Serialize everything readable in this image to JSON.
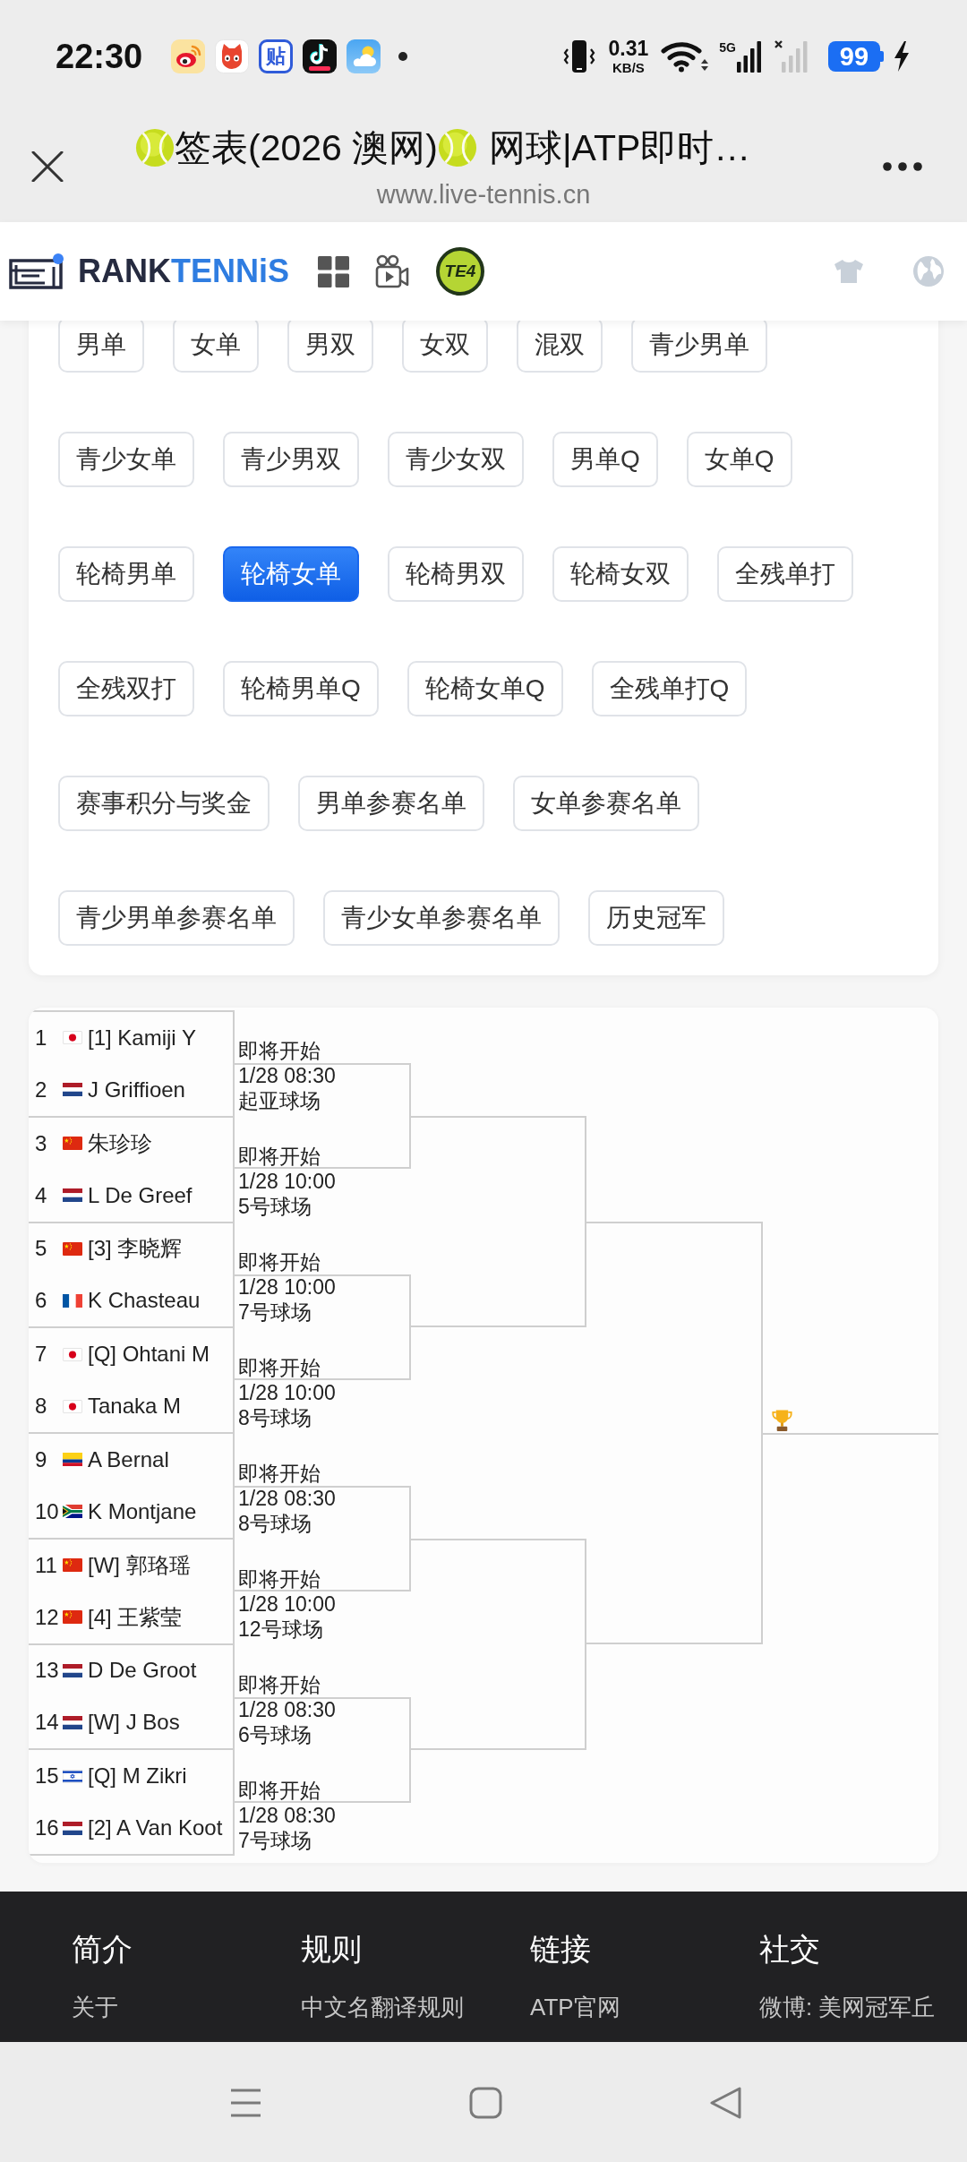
{
  "status_bar": {
    "time": "22:30",
    "app_icons": [
      {
        "kind": "eye"
      },
      {
        "kind": "cat"
      },
      {
        "kind": "glyph",
        "label": "贴"
      },
      {
        "kind": "note"
      },
      {
        "kind": "weather"
      }
    ],
    "net_speed": "0.31",
    "net_unit": "KB/S",
    "network_type": "5G",
    "battery": "99"
  },
  "browser": {
    "title": [
      {
        "ball": true,
        "text": "签表(2026 澳网)"
      },
      {
        "ball": true,
        "text": "网球|ATP即时…"
      }
    ],
    "url": "www.live-tennis.cn"
  },
  "site_header": {
    "brand": [
      "RANK",
      "TENNiS"
    ],
    "badge": "TE4"
  },
  "categories": {
    "tabs": [
      {
        "label": "男单",
        "selected": false
      },
      {
        "label": "女单",
        "selected": false
      },
      {
        "label": "男双",
        "selected": false
      },
      {
        "label": "女双",
        "selected": false
      },
      {
        "label": "混双",
        "selected": false
      },
      {
        "label": "青少男单",
        "selected": false
      },
      {
        "label": "青少女单",
        "selected": false
      },
      {
        "label": "青少男双",
        "selected": false
      },
      {
        "label": "青少女双",
        "selected": false
      },
      {
        "label": "男单Q",
        "selected": false
      },
      {
        "label": "女单Q",
        "selected": false
      },
      {
        "label": "轮椅男单",
        "selected": false
      },
      {
        "label": "轮椅女单",
        "selected": true
      },
      {
        "label": "轮椅男双",
        "selected": false
      },
      {
        "label": "轮椅女双",
        "selected": false
      },
      {
        "label": "全残单打",
        "selected": false
      },
      {
        "label": "全残双打",
        "selected": false
      },
      {
        "label": "轮椅男单Q",
        "selected": false
      },
      {
        "label": "轮椅女单Q",
        "selected": false
      },
      {
        "label": "全残单打Q",
        "selected": false
      },
      {
        "label": "赛事积分与奖金",
        "selected": false
      },
      {
        "label": "男单参赛名单",
        "selected": false
      },
      {
        "label": "女单参赛名单",
        "selected": false
      },
      {
        "label": "青少男单参赛名单",
        "selected": false
      },
      {
        "label": "青少女单参赛名单",
        "selected": false
      },
      {
        "label": "历史冠军",
        "selected": false
      }
    ]
  },
  "draw": {
    "players": [
      {
        "number": "1",
        "kind": "jp",
        "name": "[1] Kamiji Y"
      },
      {
        "number": "2",
        "kind": "nl",
        "name": "J Griffioen"
      },
      {
        "number": "3",
        "kind": "cn",
        "name": "朱珍珍"
      },
      {
        "number": "4",
        "kind": "nl",
        "name": "L De Greef"
      },
      {
        "number": "5",
        "kind": "cn",
        "name": "[3] 李晓辉"
      },
      {
        "number": "6",
        "kind": "fr",
        "name": "K Chasteau"
      },
      {
        "number": "7",
        "kind": "jp",
        "name": "[Q] Ohtani M"
      },
      {
        "number": "8",
        "kind": "jp",
        "name": "Tanaka M"
      },
      {
        "number": "9",
        "kind": "co",
        "name": "A Bernal"
      },
      {
        "number": "10",
        "kind": "za",
        "name": "K Montjane"
      },
      {
        "number": "11",
        "kind": "cn",
        "name": "[W] 郭珞瑶"
      },
      {
        "number": "12",
        "kind": "cn",
        "name": "[4] 王紫莹"
      },
      {
        "number": "13",
        "kind": "nl",
        "name": "D De Groot"
      },
      {
        "number": "14",
        "kind": "nl",
        "name": "[W] J Bos"
      },
      {
        "number": "15",
        "kind": "il",
        "name": "[Q] M Zikri"
      },
      {
        "number": "16",
        "kind": "nl",
        "name": "[2] A Van Koot"
      }
    ],
    "matches": [
      {
        "status": "即将开始",
        "time": "1/28 08:30",
        "court": "起亚球场"
      },
      {
        "status": "即将开始",
        "time": "1/28 10:00",
        "court": "5号球场"
      },
      {
        "status": "即将开始",
        "time": "1/28 10:00",
        "court": "7号球场"
      },
      {
        "status": "即将开始",
        "time": "1/28 10:00",
        "court": "8号球场"
      },
      {
        "status": "即将开始",
        "time": "1/28 08:30",
        "court": "8号球场"
      },
      {
        "status": "即将开始",
        "time": "1/28 10:00",
        "court": "12号球场"
      },
      {
        "status": "即将开始",
        "time": "1/28 08:30",
        "court": "6号球场"
      },
      {
        "status": "即将开始",
        "time": "1/28 08:30",
        "court": "7号球场"
      }
    ]
  },
  "footer": {
    "columns": [
      {
        "heading": "简介",
        "link": "关于"
      },
      {
        "heading": "规则",
        "link": "中文名翻译规则"
      },
      {
        "heading": "链接",
        "link": "ATP官网"
      },
      {
        "heading": "社交",
        "link": "微博: 美网冠军丘"
      }
    ]
  }
}
